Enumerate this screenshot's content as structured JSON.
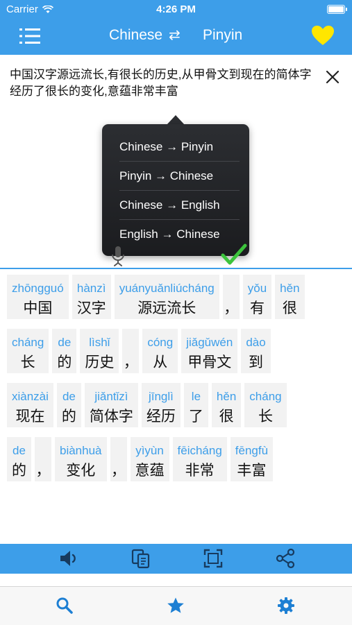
{
  "status_bar": {
    "carrier": "Carrier",
    "time": "4:26 PM"
  },
  "nav": {
    "source_lang": "Chinese",
    "swap_glyph": "⇄",
    "target_lang": "Pinyin"
  },
  "input": {
    "text": "中国汉字源远流长,有很长的历史,从甲骨文到现在的简体字经历了很长的变化,意蕴非常丰富"
  },
  "direction_menu": {
    "items": [
      "Chinese → Pinyin",
      "Pinyin → Chinese",
      "Chinese → English",
      "English → Chinese"
    ]
  },
  "result": {
    "rows": [
      [
        {
          "pinyin": "zhōngguó",
          "hanzi": "中国"
        },
        {
          "pinyin": "hànzì",
          "hanzi": "汉字"
        },
        {
          "pinyin": "yuányuǎnliúcháng",
          "hanzi": "源远流长"
        },
        {
          "pinyin": "",
          "hanzi": "，"
        },
        {
          "pinyin": "yǒu",
          "hanzi": "有"
        },
        {
          "pinyin": "hěn",
          "hanzi": "很"
        }
      ],
      [
        {
          "pinyin": "cháng",
          "hanzi": "长"
        },
        {
          "pinyin": "de",
          "hanzi": "的"
        },
        {
          "pinyin": "lìshǐ",
          "hanzi": "历史"
        },
        {
          "pinyin": "",
          "hanzi": "，"
        },
        {
          "pinyin": "cóng",
          "hanzi": "从"
        },
        {
          "pinyin": "jiǎgǔwén",
          "hanzi": "甲骨文"
        },
        {
          "pinyin": "dào",
          "hanzi": "到"
        }
      ],
      [
        {
          "pinyin": "xiànzài",
          "hanzi": "现在"
        },
        {
          "pinyin": "de",
          "hanzi": "的"
        },
        {
          "pinyin": "jiǎntǐzì",
          "hanzi": "简体字"
        },
        {
          "pinyin": "jīnglì",
          "hanzi": "经历"
        },
        {
          "pinyin": "le",
          "hanzi": "了"
        },
        {
          "pinyin": "hěn",
          "hanzi": "很"
        },
        {
          "pinyin": "cháng",
          "hanzi": "长"
        }
      ],
      [
        {
          "pinyin": "de",
          "hanzi": "的"
        },
        {
          "pinyin": "",
          "hanzi": "，"
        },
        {
          "pinyin": "biànhuà",
          "hanzi": "变化"
        },
        {
          "pinyin": "",
          "hanzi": "，"
        },
        {
          "pinyin": "yìyùn",
          "hanzi": "意蕴"
        },
        {
          "pinyin": "fēicháng",
          "hanzi": "非常"
        },
        {
          "pinyin": "fēngfù",
          "hanzi": "丰富"
        }
      ]
    ]
  },
  "icons": {
    "menu": "list-icon",
    "heart": "heart-icon",
    "clear": "close-icon",
    "mic": "microphone-icon",
    "check": "checkmark-icon",
    "toolbar": [
      "speaker-icon",
      "copy-icon",
      "fullscreen-icon",
      "share-icon"
    ],
    "tabs": [
      "search-icon",
      "star-icon",
      "gear-icon"
    ]
  },
  "colors": {
    "accent": "#3d9ee9",
    "heart": "#ffe600",
    "check": "#3cc33c",
    "menu_bg": "#1b1c1f"
  }
}
